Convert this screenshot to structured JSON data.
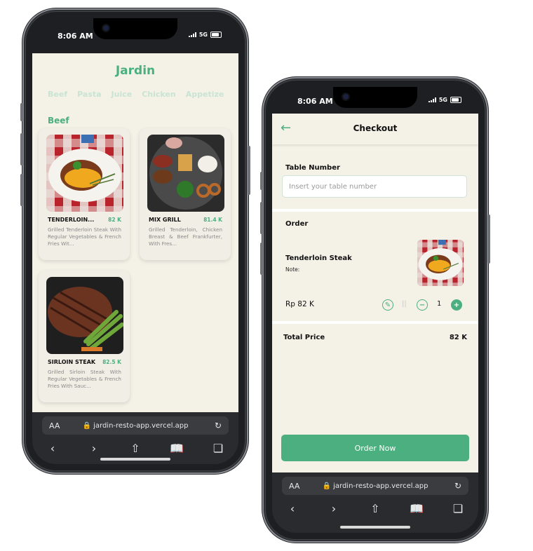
{
  "left_phone": {
    "status": {
      "time": "8:06 AM",
      "network": "5G"
    },
    "app_title": "Jardin",
    "categories": [
      "Beef",
      "Pasta",
      "Juice",
      "Chicken",
      "Appetize"
    ],
    "section_title": "Beef",
    "items": [
      {
        "name": "TENDERLOIN...",
        "price": "82 K",
        "desc": "Grilled Tenderloin Steak With Regular Vegetables & French Fries Wit..."
      },
      {
        "name": "MIX GRILL",
        "price": "81.4 K",
        "desc": "Grilled Tenderloin, Chicken Breast & Beef Frankfurter, With Fres..."
      },
      {
        "name": "SIRLOIN STEAK",
        "price": "82.5 K",
        "desc": "Grilled Sirloin Steak With Regular Vegetables & French Fries With Sauc..."
      }
    ],
    "browser": {
      "aa": "AA",
      "url": "jardin-resto-app.vercel.app"
    }
  },
  "right_phone": {
    "status": {
      "time": "8:06 AM",
      "network": "5G"
    },
    "header_title": "Checkout",
    "table_label": "Table Number",
    "table_placeholder": "Insert your table number",
    "order_label": "Order",
    "order_item": {
      "name": "Tenderloin Steak",
      "note_label": "Note:",
      "price": "Rp 82 K",
      "quantity": "1",
      "separator": "||"
    },
    "total_label": "Total Price",
    "total_value": "82 K",
    "order_button": "Order Now",
    "browser": {
      "aa": "AA",
      "url": "jardin-resto-app.vercel.app"
    }
  },
  "colors": {
    "accent": "#4caf7f",
    "bg": "#f4f1e7",
    "phone": "#1e1f22"
  }
}
